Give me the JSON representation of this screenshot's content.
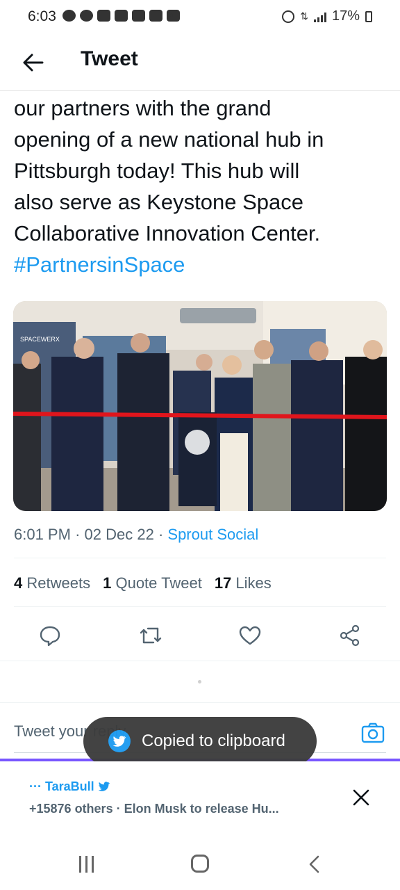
{
  "status_bar": {
    "time": "6:03",
    "battery": "17%",
    "icons": [
      "facebook-icon",
      "facebook-icon",
      "youtube-icon",
      "youtube-icon",
      "youtube-icon",
      "youtube-icon",
      "youtube-icon",
      "alarm-icon",
      "network-icon",
      "signal-icon",
      "battery-icon"
    ]
  },
  "header": {
    "title": "Tweet",
    "back_icon": "arrow-left-icon"
  },
  "tweet": {
    "text_lines": [
      "our partners with the grand",
      "opening of a new national hub in",
      "Pittsburgh today! This hub will",
      "also serve as Keystone Space",
      "Collaborative Innovation Center."
    ],
    "hashtag": "#PartnersinSpace",
    "image_alt": "ribbon-cutting-photo",
    "image_banner_text": "SPACEWERX",
    "time": "6:01 PM",
    "date": "02 Dec 22",
    "source": "Sprout Social",
    "sep": "·"
  },
  "stats": {
    "retweets_count": "4",
    "retweets_label": "Retweets",
    "quotes_count": "1",
    "quotes_label": "Quote Tweet",
    "likes_count": "17",
    "likes_label": "Likes"
  },
  "actions": [
    "reply-icon",
    "retweet-icon",
    "like-icon",
    "share-icon"
  ],
  "reply": {
    "placeholder": "Tweet your reply"
  },
  "toast": {
    "text": "Copied to clipboard"
  },
  "notification": {
    "author": "··· TaraBull",
    "body": "+15876 others · Elon Musk to release Hu..."
  },
  "colors": {
    "accent": "#1d9bf0",
    "divider_purple": "#7856ff",
    "toast_bg": "#3c3c3c"
  }
}
